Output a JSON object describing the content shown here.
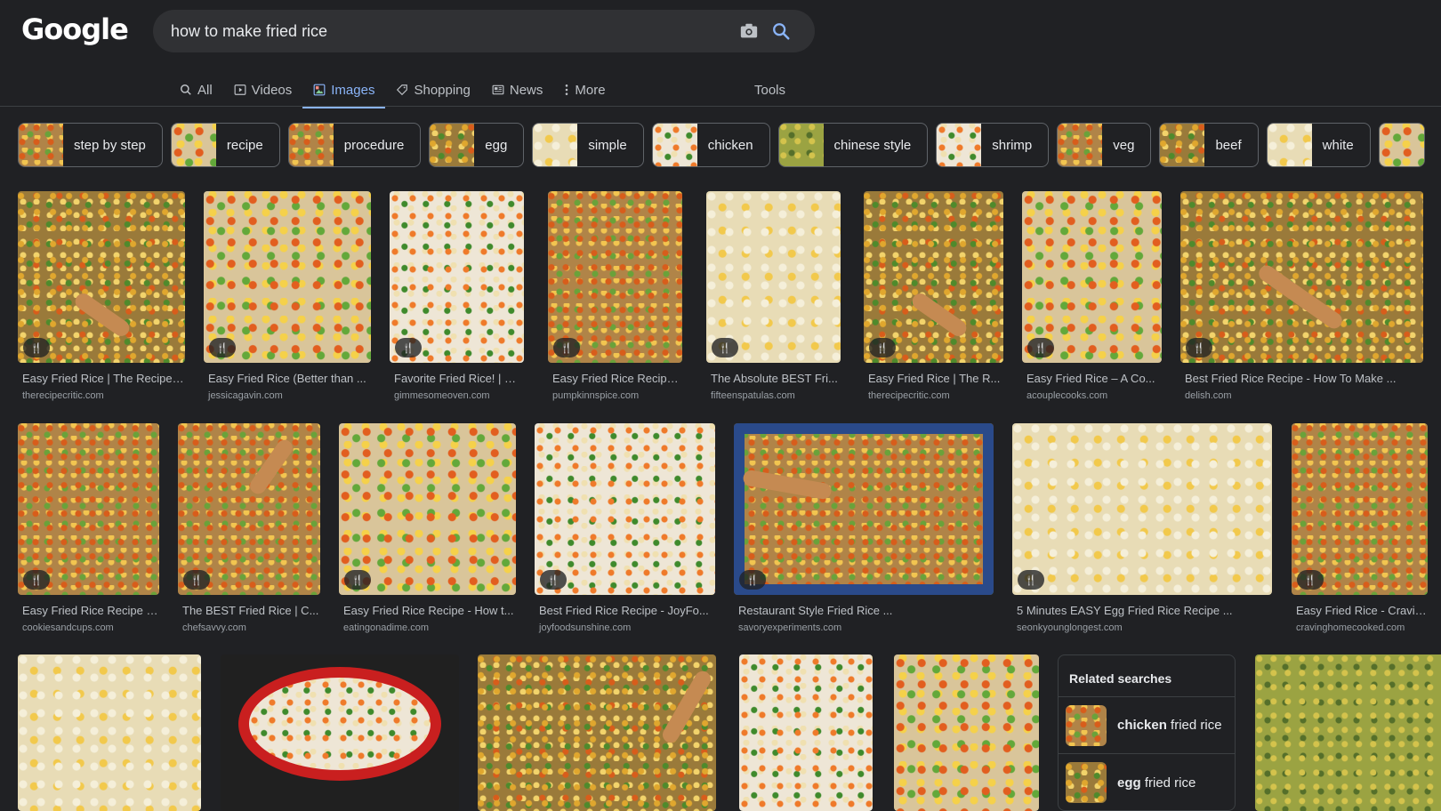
{
  "header": {
    "logo": "Google",
    "query": "how to make fried rice"
  },
  "tabs": [
    {
      "label": "All",
      "icon": "search-icon"
    },
    {
      "label": "Videos",
      "icon": "play-icon"
    },
    {
      "label": "Images",
      "icon": "image-icon"
    },
    {
      "label": "Shopping",
      "icon": "tag-icon"
    },
    {
      "label": "News",
      "icon": "newspaper-icon"
    },
    {
      "label": "More",
      "icon": "dots-vertical-icon"
    }
  ],
  "tools_label": "Tools",
  "chips": [
    {
      "label": "step by step"
    },
    {
      "label": "recipe"
    },
    {
      "label": "procedure"
    },
    {
      "label": "egg"
    },
    {
      "label": "simple"
    },
    {
      "label": "chicken"
    },
    {
      "label": "chinese style"
    },
    {
      "label": "shrimp"
    },
    {
      "label": "veg"
    },
    {
      "label": "beef"
    },
    {
      "label": "white"
    }
  ],
  "results": [
    {
      "title": "Easy Fried Rice | The Recipe ...",
      "source": "therecipecritic.com"
    },
    {
      "title": "Easy Fried Rice (Better than ...",
      "source": "jessicagavin.com"
    },
    {
      "title": "Favorite Fried Rice! | Gi...",
      "source": "gimmesomeoven.com"
    },
    {
      "title": "Easy Fried Rice Recipe ...",
      "source": "pumpkinnspice.com"
    },
    {
      "title": "The Absolute BEST Fri...",
      "source": "fifteenspatulas.com"
    },
    {
      "title": "Easy Fried Rice | The R...",
      "source": "therecipecritic.com"
    },
    {
      "title": "Easy Fried Rice – A Co...",
      "source": "acouplecooks.com"
    },
    {
      "title": "Best Fried Rice Recipe - How To Make ...",
      "source": "delish.com"
    },
    {
      "title": "Easy Fried Rice Recipe -...",
      "source": "cookiesandcups.com"
    },
    {
      "title": "The BEST Fried Rice | C...",
      "source": "chefsavvy.com"
    },
    {
      "title": "Easy Fried Rice Recipe - How t...",
      "source": "eatingonadime.com"
    },
    {
      "title": "Best Fried Rice Recipe - JoyFo...",
      "source": "joyfoodsunshine.com"
    },
    {
      "title": "Restaurant Style Fried Rice ...",
      "source": "savoryexperiments.com"
    },
    {
      "title": "5 Minutes EASY Egg Fried Rice Recipe ...",
      "source": "seonkyounglongest.com"
    },
    {
      "title": "Easy Fried Rice - Cravin...",
      "source": "cravinghomecooked.com"
    }
  ],
  "related": {
    "title": "Related searches",
    "items": [
      {
        "bold": "chicken",
        "rest": " fried rice"
      },
      {
        "bold": "egg",
        "rest": " fried rice"
      }
    ]
  },
  "colors": {
    "background": "#202124",
    "accent": "#8ab4f8",
    "text": "#e8eaed"
  }
}
